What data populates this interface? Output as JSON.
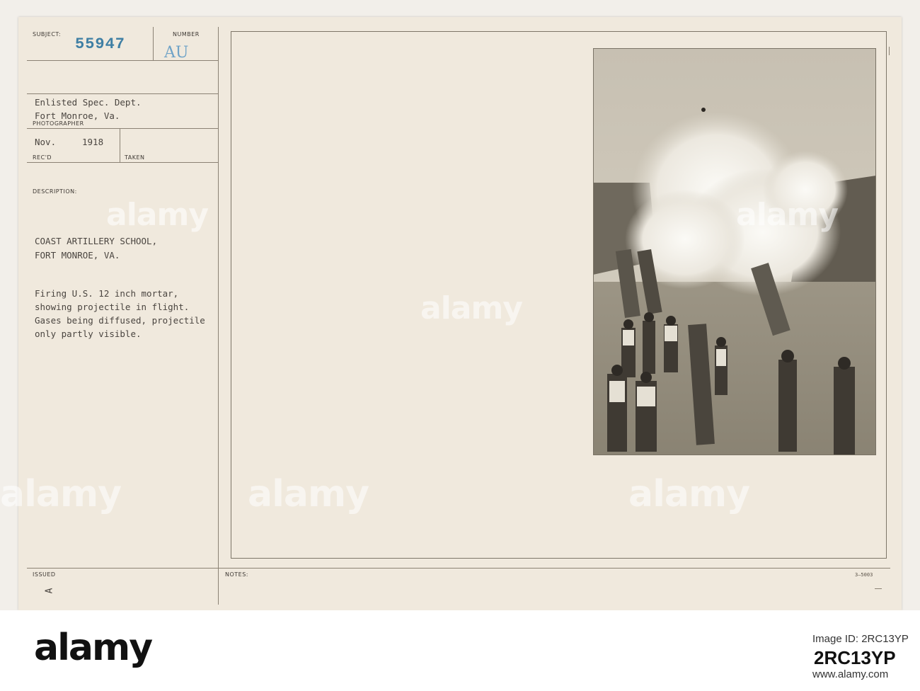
{
  "card": {
    "subject_label": "SUBJECT:",
    "number_label": "NUMBER",
    "subject_number": "55947",
    "number_code": "AU",
    "photographer_line1": "Enlisted Spec. Dept.",
    "photographer_line2": "Fort Monroe, Va.",
    "photographer_label": "PHOTOGRAPHER",
    "recd_month": "Nov.",
    "recd_year": "1918",
    "recd_label": "REC'D",
    "taken_label": "TAKEN",
    "description_label": "DESCRIPTION:",
    "desc_line1": "COAST ARTILLERY SCHOOL,",
    "desc_line2": "FORT MONROE, VA.",
    "desc_line3": "Firing U.S. 12 inch mortar,",
    "desc_line4": "showing projectile in flight.",
    "desc_line5": "Gases being diffused, projectile",
    "desc_line6": "only partly visible.",
    "issued_label": "ISSUED",
    "issued_mark": "A",
    "notes_label": "NOTES:",
    "form_number": "3—5003"
  },
  "watermark": "alamy",
  "footer": {
    "logo": "alamy",
    "image_id_label": "Image ID: 2RC13YP",
    "site": "www.alamy.com",
    "image_id": "2RC13YP"
  }
}
